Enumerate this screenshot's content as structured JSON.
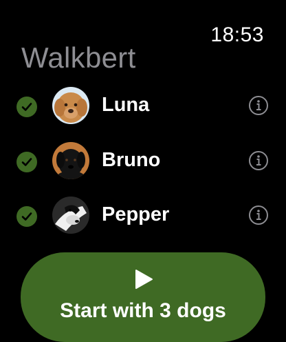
{
  "status_bar": {
    "time": "18:53"
  },
  "app": {
    "title": "Walkbert"
  },
  "dogs": [
    {
      "name": "Luna",
      "selected": true,
      "avatar": "golden-doodle-photo"
    },
    {
      "name": "Bruno",
      "selected": true,
      "avatar": "black-labrador-puppy-photo"
    },
    {
      "name": "Pepper",
      "selected": true,
      "avatar": "black-white-dog-photo"
    }
  ],
  "start_button": {
    "label": "Start with 3 dogs",
    "icon": "play-icon"
  },
  "colors": {
    "accent": "#3f6a24",
    "title_gray": "#8e8e93",
    "background": "#000000"
  }
}
